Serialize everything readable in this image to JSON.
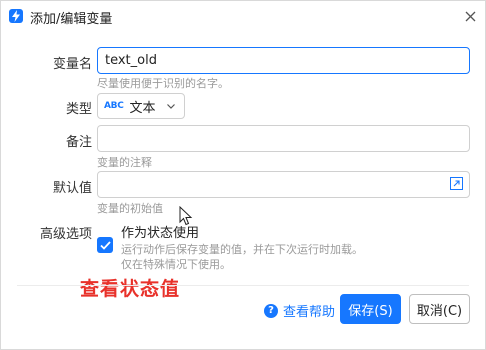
{
  "dialog": {
    "title": "添加/编辑变量",
    "icon": "app-lightning-icon",
    "close_icon": "close-icon"
  },
  "form": {
    "name": {
      "label": "变量名",
      "value": "text_old",
      "hint": "尽量使用便于识别的名字。"
    },
    "type": {
      "label": "类型",
      "icon_text": "ABC",
      "value": "文本"
    },
    "remark": {
      "label": "备注",
      "value": "",
      "hint": "变量的注释"
    },
    "default": {
      "label": "默认值",
      "value": "",
      "hint": "变量的初始值"
    },
    "advanced": {
      "label": "高级选项",
      "checkbox_label": "作为状态使用",
      "checked": true,
      "desc_line1": "运行动作后保存变量的值，并在下次运行时加载。",
      "desc_line2": "仅在特殊情况下使用。"
    }
  },
  "annotation": "查看状态值",
  "footer": {
    "help_label": "查看帮助",
    "save_label": "保存(S)",
    "cancel_label": "取消(C)"
  },
  "colors": {
    "accent": "#1677ff",
    "annotation": "#e8312a"
  }
}
